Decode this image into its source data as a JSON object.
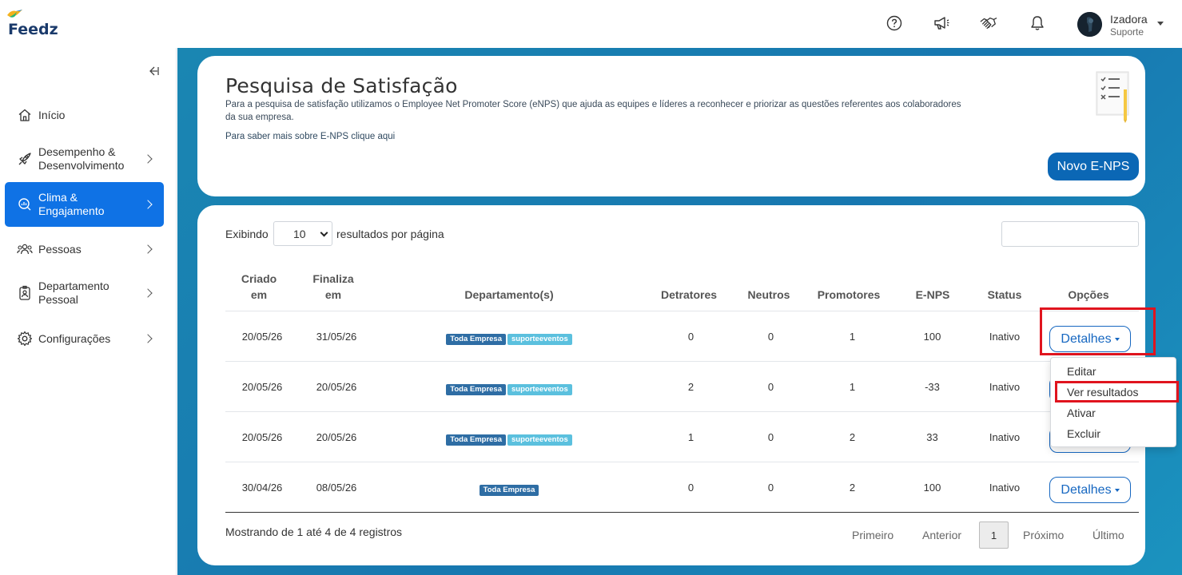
{
  "brand": {
    "name": "Feedz"
  },
  "header": {
    "icons": [
      "help-icon",
      "megaphone-icon",
      "handshake-icon",
      "bell-icon"
    ],
    "user": {
      "name": "Izadora",
      "role": "Suporte"
    }
  },
  "sidebar": {
    "items": [
      {
        "label": "Início",
        "icon": "home-icon",
        "active": false
      },
      {
        "label": "Desempenho &\nDesenvolvimento",
        "icon": "rocket-icon",
        "active": false
      },
      {
        "label": "Clima &\nEngajamento",
        "icon": "chart-search-icon",
        "active": true
      },
      {
        "label": "Pessoas",
        "icon": "people-icon",
        "active": false
      },
      {
        "label": "Departamento\nPessoal",
        "icon": "id-badge-icon",
        "active": false
      },
      {
        "label": "Configurações",
        "icon": "gear-icon",
        "active": false
      }
    ]
  },
  "intro": {
    "title": "Pesquisa de Satisfação",
    "description": "Para a pesquisa de satisfação utilizamos o Employee Net Promoter Score (eNPS) que ajuda as equipes e líderes a reconhecer e priorizar as questões referentes aos colaboradores da sua empresa.",
    "learn_more": "Para saber mais sobre E-NPS clique aqui",
    "new_button": "Novo E-NPS"
  },
  "table_controls": {
    "show_label": "Exibindo",
    "page_size": "10",
    "per_page_label": "resultados por página",
    "search_value": ""
  },
  "table": {
    "headers": {
      "created": "Criado\nem",
      "ends": "Finaliza\nem",
      "departments": "Departamento(s)",
      "detractors": "Detratores",
      "neutrals": "Neutros",
      "promoters": "Promotores",
      "enps": "E-NPS",
      "status": "Status",
      "options": "Opções"
    },
    "rows": [
      {
        "created": "20/05/26",
        "ends": "31/05/26",
        "tags": [
          "Toda Empresa",
          "suporteeventos"
        ],
        "detractors": "0",
        "neutrals": "0",
        "promoters": "1",
        "enps": "100",
        "status": "Inativo"
      },
      {
        "created": "20/05/26",
        "ends": "20/05/26",
        "tags": [
          "Toda Empresa",
          "suporteeventos"
        ],
        "detractors": "2",
        "neutrals": "0",
        "promoters": "1",
        "enps": "-33",
        "status": "Inativo"
      },
      {
        "created": "20/05/26",
        "ends": "20/05/26",
        "tags": [
          "Toda Empresa",
          "suporteeventos"
        ],
        "detractors": "1",
        "neutrals": "0",
        "promoters": "2",
        "enps": "33",
        "status": "Inativo"
      },
      {
        "created": "30/04/26",
        "ends": "08/05/26",
        "tags": [
          "Toda Empresa"
        ],
        "detractors": "0",
        "neutrals": "0",
        "promoters": "2",
        "enps": "100",
        "status": "Inativo"
      }
    ],
    "details_label": "Detalhes"
  },
  "dropdown": {
    "items": [
      "Editar",
      "Ver resultados",
      "Ativar",
      "Excluir"
    ]
  },
  "footer": {
    "info": "Mostrando de 1 até 4 de 4 registros",
    "first": "Primeiro",
    "prev": "Anterior",
    "current": "1",
    "next": "Próximo",
    "last": "Último"
  },
  "colors": {
    "primary": "#0b67b5",
    "active_nav": "#0f72e5",
    "highlight": "#e0141e",
    "badge_dark": "#2e6da4",
    "badge_light": "#5bc0de"
  }
}
